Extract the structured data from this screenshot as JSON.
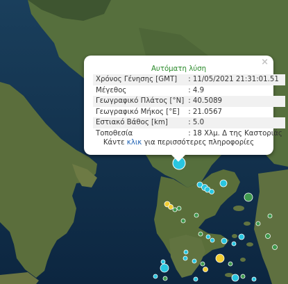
{
  "popup": {
    "title": "Αυτόματη λύση",
    "close": "×",
    "rows": [
      {
        "label": "Χρόνος Γένησης [GMT]",
        "value": ": 11/05/2021 21:31:01.51"
      },
      {
        "label": "Μέγεθος",
        "value": ": 4.9"
      },
      {
        "label": "Γεωγραφικό Πλάτος [°N]",
        "value": ": 40.5089"
      },
      {
        "label": "Γεωγραφικό Μήκος [°E]",
        "value": ": 21.0567"
      },
      {
        "label": "Εστιακό Βάθος [km]",
        "value": ": 5.0"
      },
      {
        "label": "Τοποθεσία",
        "value": ": 18 Χλμ. Δ της Καστοριάς"
      }
    ],
    "footer_pre": "Κάντε ",
    "footer_link": "κλικ",
    "footer_post": " για περισσότερες πληροφορίες"
  },
  "colors": {
    "sea_deep": "#0f2e48",
    "land": "#4f6b3a",
    "marker_cyan": "#29c6e0",
    "marker_yellow": "#f2cd32",
    "marker_green": "#3f9a4f",
    "title_green": "#2a8a2a",
    "link_blue": "#1a5fb4"
  }
}
